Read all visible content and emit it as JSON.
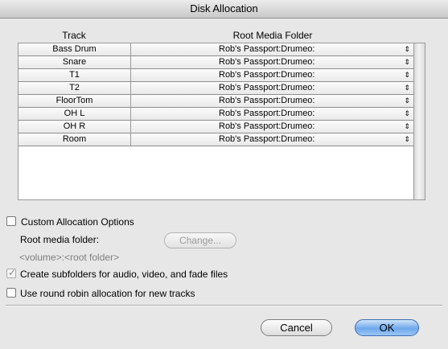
{
  "window": {
    "title": "Disk Allocation"
  },
  "table": {
    "headers": {
      "track": "Track",
      "root_folder": "Root Media Folder"
    },
    "rows": [
      {
        "track": "Bass Drum",
        "folder": "Rob's Passport:Drumeo:"
      },
      {
        "track": "Snare",
        "folder": "Rob's Passport:Drumeo:"
      },
      {
        "track": "T1",
        "folder": "Rob's Passport:Drumeo:"
      },
      {
        "track": "T2",
        "folder": "Rob's Passport:Drumeo:"
      },
      {
        "track": "FloorTom",
        "folder": "Rob's Passport:Drumeo:"
      },
      {
        "track": "OH L",
        "folder": "Rob's Passport:Drumeo:"
      },
      {
        "track": "OH R",
        "folder": "Rob's Passport:Drumeo:"
      },
      {
        "track": "Room",
        "folder": "Rob's Passport:Drumeo:"
      }
    ],
    "popup_arrows": "⇕"
  },
  "options": {
    "custom_allocation": {
      "label": "Custom Allocation Options",
      "checked": false
    },
    "root_media_label": "Root media folder:",
    "change_button": "Change...",
    "volume_path": "<volume>:<root folder>",
    "create_subfolders": {
      "label": "Create subfolders for audio, video, and fade files",
      "checked": true,
      "disabled": true
    },
    "round_robin": {
      "label": "Use round robin allocation for new tracks",
      "checked": false
    }
  },
  "buttons": {
    "cancel": "Cancel",
    "ok": "OK"
  },
  "colors": {
    "ok_button": "#6fa8ec",
    "dialog_bg": "#e7e7e7"
  }
}
